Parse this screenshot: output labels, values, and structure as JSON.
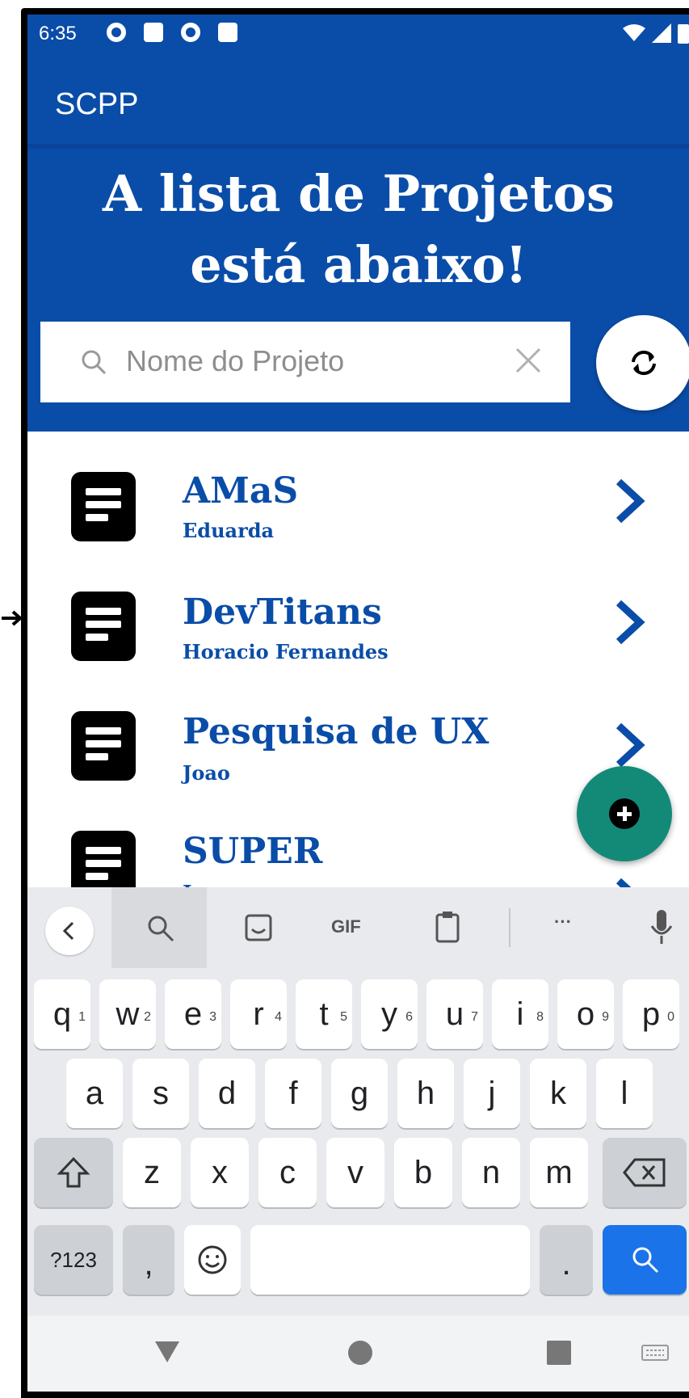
{
  "status_bar": {
    "time": "6:35"
  },
  "app_bar": {
    "title": "SCPP"
  },
  "header": {
    "headline": "A lista de Projetos está abaixo!"
  },
  "search": {
    "placeholder": "Nome do Projeto"
  },
  "projects": [
    {
      "name": "AMaS",
      "owner": "Eduarda"
    },
    {
      "name": "DevTitans",
      "owner": "Horacio Fernandes"
    },
    {
      "name": "Pesquisa de UX",
      "owner": "Joao"
    },
    {
      "name": "SUPER",
      "owner": "Jose"
    }
  ],
  "keyboard": {
    "suggestion_gif": "GIF",
    "suggestion_more": "···",
    "row1": [
      {
        "k": "q",
        "h": "1"
      },
      {
        "k": "w",
        "h": "2"
      },
      {
        "k": "e",
        "h": "3"
      },
      {
        "k": "r",
        "h": "4"
      },
      {
        "k": "t",
        "h": "5"
      },
      {
        "k": "y",
        "h": "6"
      },
      {
        "k": "u",
        "h": "7"
      },
      {
        "k": "i",
        "h": "8"
      },
      {
        "k": "o",
        "h": "9"
      },
      {
        "k": "p",
        "h": "0"
      }
    ],
    "row2": [
      "a",
      "s",
      "d",
      "f",
      "g",
      "h",
      "j",
      "k",
      "l"
    ],
    "row3": [
      "z",
      "x",
      "c",
      "v",
      "b",
      "n",
      "m"
    ],
    "symbols_key": "?123",
    "comma_key": ",",
    "period_key": "."
  },
  "colors": {
    "primary": "#0a4da8",
    "fab": "#138a78",
    "keyboard_bg": "#e8eaed",
    "action_key": "#1a73e8"
  }
}
